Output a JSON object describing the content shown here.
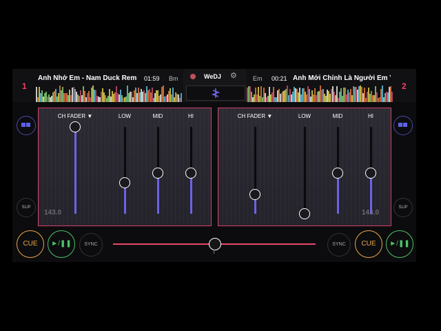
{
  "deck_left": {
    "number": "1",
    "title": "Anh Nhớ Em - Nam Duck Remix",
    "time": "01:59",
    "key": "Bm",
    "bpm": "143.0"
  },
  "deck_right": {
    "number": "2",
    "title": "Anh Mới Chính Là Người Em Yêu",
    "time": "00:21",
    "key": "Em",
    "bpm": "143.0"
  },
  "center": {
    "brand": "WeDJ",
    "settings_icon": "gear-icon",
    "fx_icon": "waveform-icon"
  },
  "mixer_left": {
    "labels": {
      "ch_fader": "CH FADER ▼",
      "low": "LOW",
      "mid": "MID",
      "hi": "HI"
    },
    "levels": {
      "ch_fader": 1.0,
      "low": 0.36,
      "mid": 0.47,
      "hi": 0.47
    }
  },
  "mixer_right": {
    "labels": {
      "ch_fader": "CH FADER ▼",
      "low": "LOW",
      "mid": "MID",
      "hi": "HI"
    },
    "levels": {
      "ch_fader": 0.22,
      "low": 0.0,
      "mid": 0.47,
      "hi": 0.47
    }
  },
  "buttons": {
    "cue": "CUE",
    "play": "►/❚❚",
    "sync": "SYNC",
    "slip": "SLIP"
  },
  "crossfader": {
    "position": 0.5
  },
  "colors": {
    "accent": "#e8476b",
    "fader_fill": "#6d63e6",
    "cue": "#e9a84a",
    "play": "#4ec36b"
  }
}
